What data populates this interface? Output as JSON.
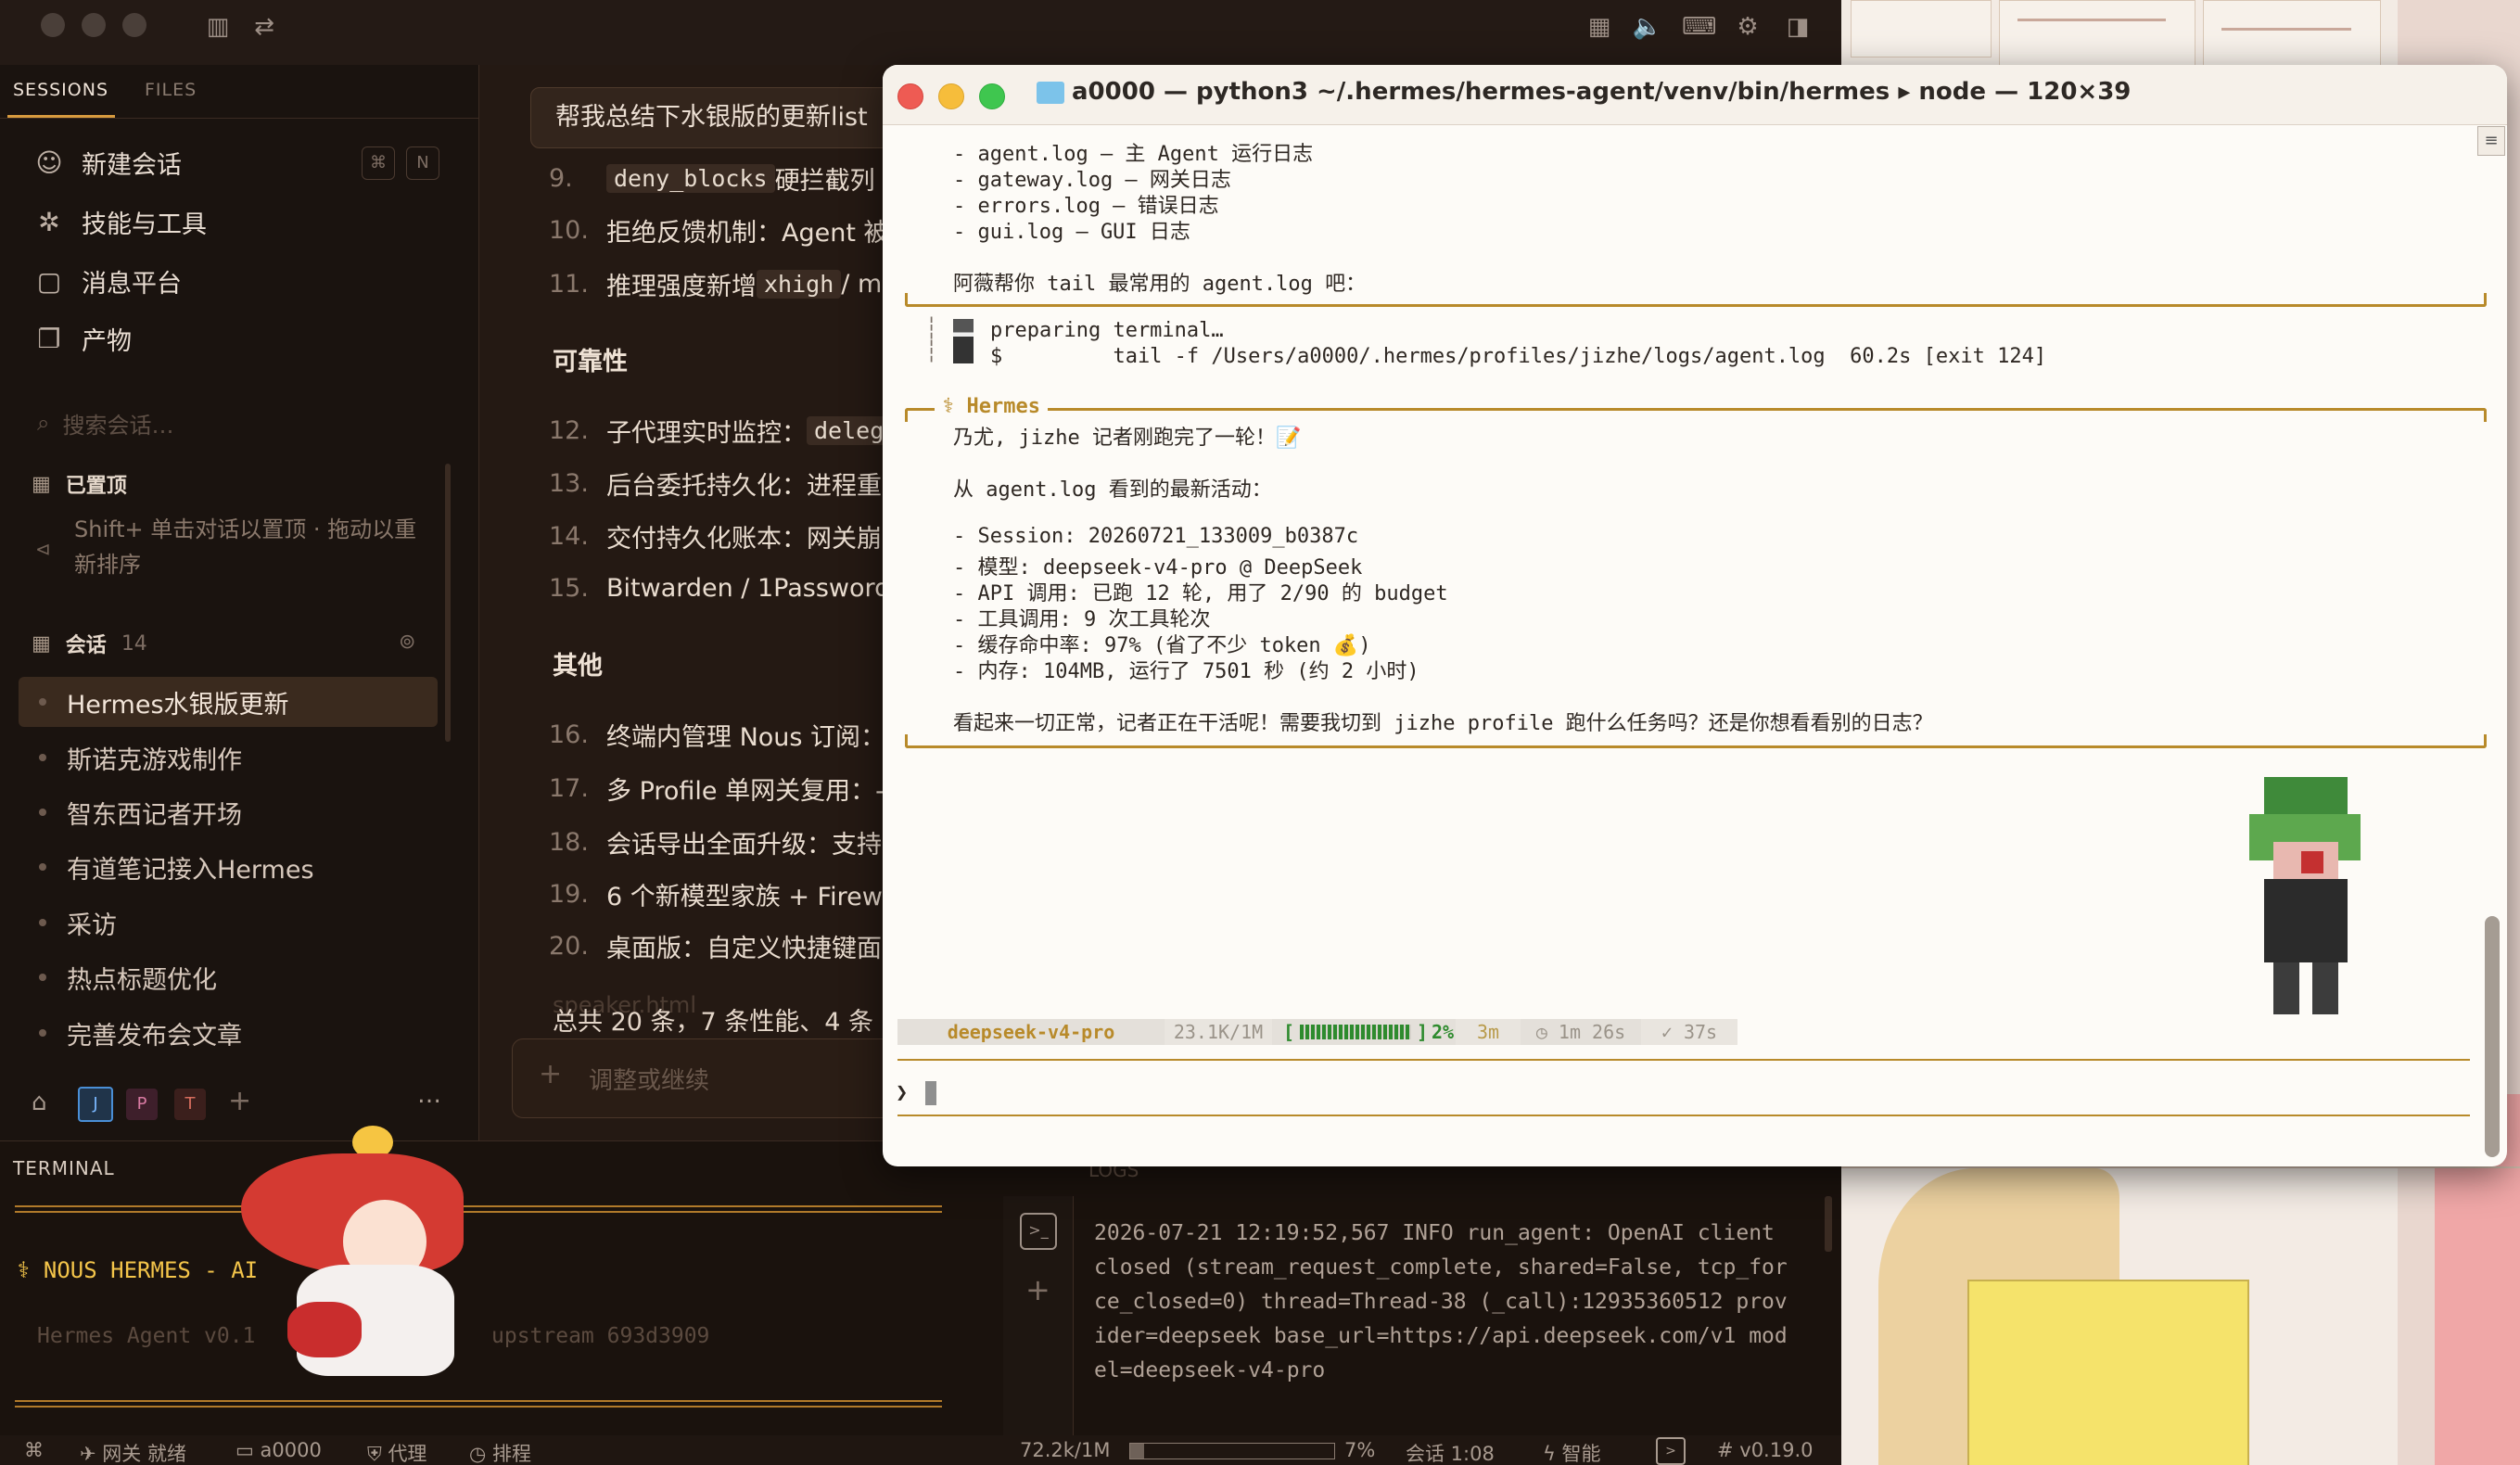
{
  "sidebar": {
    "tabs": {
      "sessions": "SESSIONS",
      "files": "FILES"
    },
    "nav": [
      {
        "icon": "chat-icon",
        "label": "新建会话"
      },
      {
        "icon": "puzzle-icon",
        "label": "技能与工具"
      },
      {
        "icon": "message-icon",
        "label": "消息平台"
      },
      {
        "icon": "file-icon",
        "label": "产物"
      }
    ],
    "shortcut": {
      "k1": "⌘",
      "k2": "N"
    },
    "search_placeholder": "搜索会话…",
    "pinned": {
      "title": "已置顶",
      "hint": "Shift+ 单击对话以置顶 · 拖动以重新排序"
    },
    "sessions": {
      "title": "会话",
      "count": "14"
    },
    "session_items": [
      "Hermes水银版更新",
      "斯诺克游戏制作",
      "智东西记者开场",
      "有道笔记接入Hermes",
      "采访",
      "热点标题优化",
      "完善发布会文章"
    ],
    "profiles": [
      "J",
      "P",
      "T"
    ],
    "more": "…"
  },
  "chat": {
    "user_message": "帮我总结下水银版的更新list",
    "lines": [
      {
        "n": "9.",
        "pre": "",
        "code": "deny_blocks",
        "post": " 硬拦截列"
      },
      {
        "n": "10.",
        "pre": "拒绝反馈机制：Agent 被",
        "code": "",
        "post": ""
      },
      {
        "n": "11.",
        "pre": "推理强度新增 ",
        "code": "xhigh",
        "post": " / m"
      }
    ],
    "section_reliability": "可靠性",
    "lines2": [
      {
        "n": "12.",
        "pre": "子代理实时监控：",
        "code": "deleg",
        "post": ""
      },
      {
        "n": "13.",
        "pre": "后台委托持久化：进程重",
        "code": "",
        "post": ""
      },
      {
        "n": "14.",
        "pre": "交付持久化账本：网关崩",
        "code": "",
        "post": ""
      },
      {
        "n": "15.",
        "pre": "Bitwarden / 1Password",
        "code": "",
        "post": ""
      }
    ],
    "section_other": "其他",
    "lines3": [
      {
        "n": "16.",
        "text": "终端内管理 Nous 订阅："
      },
      {
        "n": "17.",
        "text": "多 Profile 单网关复用：-"
      },
      {
        "n": "18.",
        "text": "会话导出全面升级：支持"
      },
      {
        "n": "19.",
        "text": "6 个新模型家族 + Firew"
      },
      {
        "n": "20.",
        "text": "桌面版：自定义快捷键面"
      }
    ],
    "summary": "总共 20 条，7 条性能、4 条",
    "faded_file": "speaker.html",
    "input_placeholder": "调整或继续"
  },
  "terminal_panel": {
    "title": "TERMINAL",
    "banner": "⚕ NOUS HERMES - AI",
    "version_line": "Hermes Agent v0.1",
    "upstream": "upstream 693d3909",
    "logs_title": "LOGS",
    "log_text": "2026-07-21 12:19:52,567 INFO run_agent: OpenAI client closed (stream_request_complete, shared=False, tcp_force_closed=0) thread=Thread-38 (_call):12935360512 provider=deepseek base_url=https://api.deepseek.com/v1 model=deepseek-v4-pro"
  },
  "statusbar": {
    "gateway": "网关 就绪",
    "folder": "a0000",
    "proxy": "代理",
    "schedule": "排程",
    "tokens": "72.2k/1M",
    "percent": "7%",
    "session": "会话 1:08",
    "smart": "智能",
    "version": "# v0.19.0"
  },
  "terminal": {
    "title": "a0000 — python3 ~/.hermes/hermes-agent/venv/bin/hermes ▸ node — 120×39",
    "lines_top": [
      "- agent.log — 主 Agent 运行日志",
      "- gateway.log — 网关日志",
      "- errors.log — 错误日志",
      "- gui.log — GUI 日志",
      "",
      "阿薇帮你 tail 最常用的 agent.log 吧："
    ],
    "tool_prep": "preparing terminal…",
    "tool_cmd": "$         tail -f /Users/a0000/.hermes/profiles/jizhe/logs/agent.log  60.2s [exit 124]",
    "response_title": "⚕ Hermes",
    "lines_resp": [
      "乃尤, jizhe 记者刚跑完了一轮！📝",
      "",
      "从 agent.log 看到的最新活动：",
      "",
      "- Session: 20260721_133009_b0387c",
      "- 模型: deepseek-v4-pro @ DeepSeek",
      "- API 调用: 已跑 12 轮, 用了 2/90 的 budget",
      "- 工具调用: 9 次工具轮次",
      "- 缓存命中率: 97% (省了不少 token 💰)",
      "- 内存: 104MB, 运行了 7501 秒 (约 2 小时)",
      "",
      "看起来一切正常，记者正在干活呢！需要我切到 jizhe profile 跑什么任务吗？还是你想看看别的日志？"
    ],
    "status": {
      "model": "deepseek-v4-pro",
      "ctx": "23.1K/1M",
      "bar_open": "[",
      "bar_close": "]",
      "percent": "2%",
      "elapsed": "3m",
      "timer": "◷ 1m 26s",
      "last": "✓ 37s"
    },
    "prompt": "❯"
  }
}
